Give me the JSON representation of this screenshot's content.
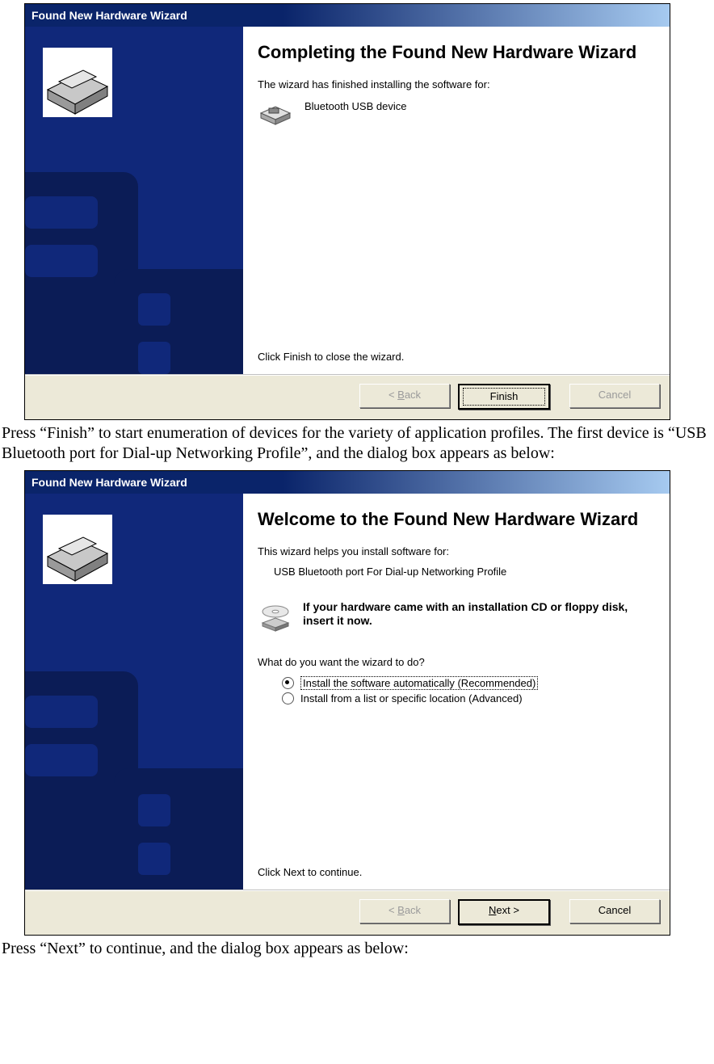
{
  "dialog1": {
    "title": "Found New Hardware Wizard",
    "heading": "Completing the Found New Hardware Wizard",
    "finished_text": "The wizard has finished installing the software for:",
    "device_name": "Bluetooth USB device",
    "close_text": "Click Finish to close the wizard.",
    "buttons": {
      "back": "< Back",
      "back_u": "B",
      "finish": "Finish",
      "cancel": "Cancel"
    }
  },
  "para1": "Press “Finish” to start enumeration of devices for the variety of application profiles. The first device is “USB Bluetooth port for Dial-up Networking Profile”, and the dialog box appears as below:",
  "dialog2": {
    "title": "Found New Hardware Wizard",
    "heading": "Welcome to the Found New Hardware Wizard",
    "helps_text": "This wizard helps you install software for:",
    "device_name": "USB Bluetooth port For Dial-up Networking Profile",
    "cd_text": "If your hardware came with an installation CD or floppy disk, insert it now.",
    "question": "What do you want the wizard to do?",
    "radio1": "Install the software automatically (Recommended)",
    "radio2": "Install from a list or specific location (Advanced)",
    "continue_text": "Click Next to continue.",
    "buttons": {
      "back_pre": "< ",
      "back_u": "B",
      "back_post": "ack",
      "next_u": "N",
      "next_post": "ext >",
      "cancel": "Cancel"
    }
  },
  "para2": "Press “Next” to continue, and the dialog box appears as below:"
}
